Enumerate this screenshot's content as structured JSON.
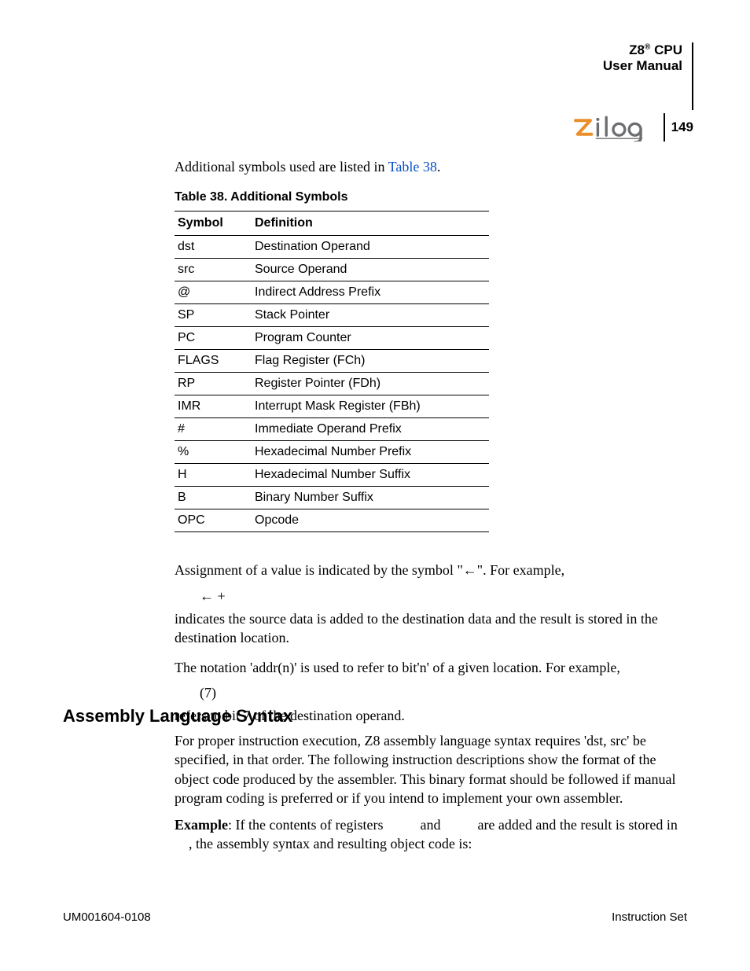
{
  "header": {
    "title_line1_pre": "Z8",
    "title_line1_sup": "®",
    "title_line1_post": " CPU",
    "title_line2": "User Manual",
    "page_number": "149"
  },
  "intro_para_pre": "Additional symbols used are listed in ",
  "intro_link": "Table 38",
  "intro_para_post": ".",
  "table_caption": "Table 38. Additional Symbols",
  "table_headers": {
    "col1": "Symbol",
    "col2": "Definition"
  },
  "table_rows": [
    {
      "sym": "dst",
      "def": "Destination Operand"
    },
    {
      "sym": "src",
      "def": "Source Operand"
    },
    {
      "sym": "@",
      "def": "Indirect Address Prefix"
    },
    {
      "sym": "SP",
      "def": "Stack Pointer"
    },
    {
      "sym": "PC",
      "def": "Program Counter"
    },
    {
      "sym": "FLAGS",
      "def": "Flag Register (FCh)"
    },
    {
      "sym": "RP",
      "def": "Register Pointer (FDh)"
    },
    {
      "sym": "IMR",
      "def": "Interrupt Mask Register (FBh)"
    },
    {
      "sym": "#",
      "def": "Immediate Operand Prefix"
    },
    {
      "sym": "%",
      "def": "Hexadecimal Number Prefix"
    },
    {
      "sym": "H",
      "def": "Hexadecimal Number Suffix"
    },
    {
      "sym": "B",
      "def": "Binary Number Suffix"
    },
    {
      "sym": "OPC",
      "def": "Opcode"
    }
  ],
  "assign_para": "Assignment of a value is indicated by the symbol \"←\". For example,",
  "assign_expr": "←        +",
  "assign_result": "indicates the source data is added to the destination data and the result is stored in the destination location.",
  "notation_para": "The notation 'addr(n)' is used to refer to bit'n' of a given location. For example,",
  "notation_expr": "(7)",
  "notation_result": "refers to bit 7 of the destination operand.",
  "section_heading": "Assembly Language Syntax",
  "syntax_para": "For proper instruction execution, Z8 assembly language syntax requires 'dst, src' be specified, in that order. The following instruction descriptions show the format of the object code produced by the assembler. This binary format should be followed if manual program coding is preferred or if you intend to implement your own assembler.",
  "example_label": "Example",
  "example_text_a": ": If the contents of registers ",
  "example_text_b": " and ",
  "example_text_c": " are added and the result is stored in ",
  "example_text_d": ", the assembly syntax and resulting object code is:",
  "footer": {
    "left": "UM001604-0108",
    "right": "Instruction Set"
  }
}
